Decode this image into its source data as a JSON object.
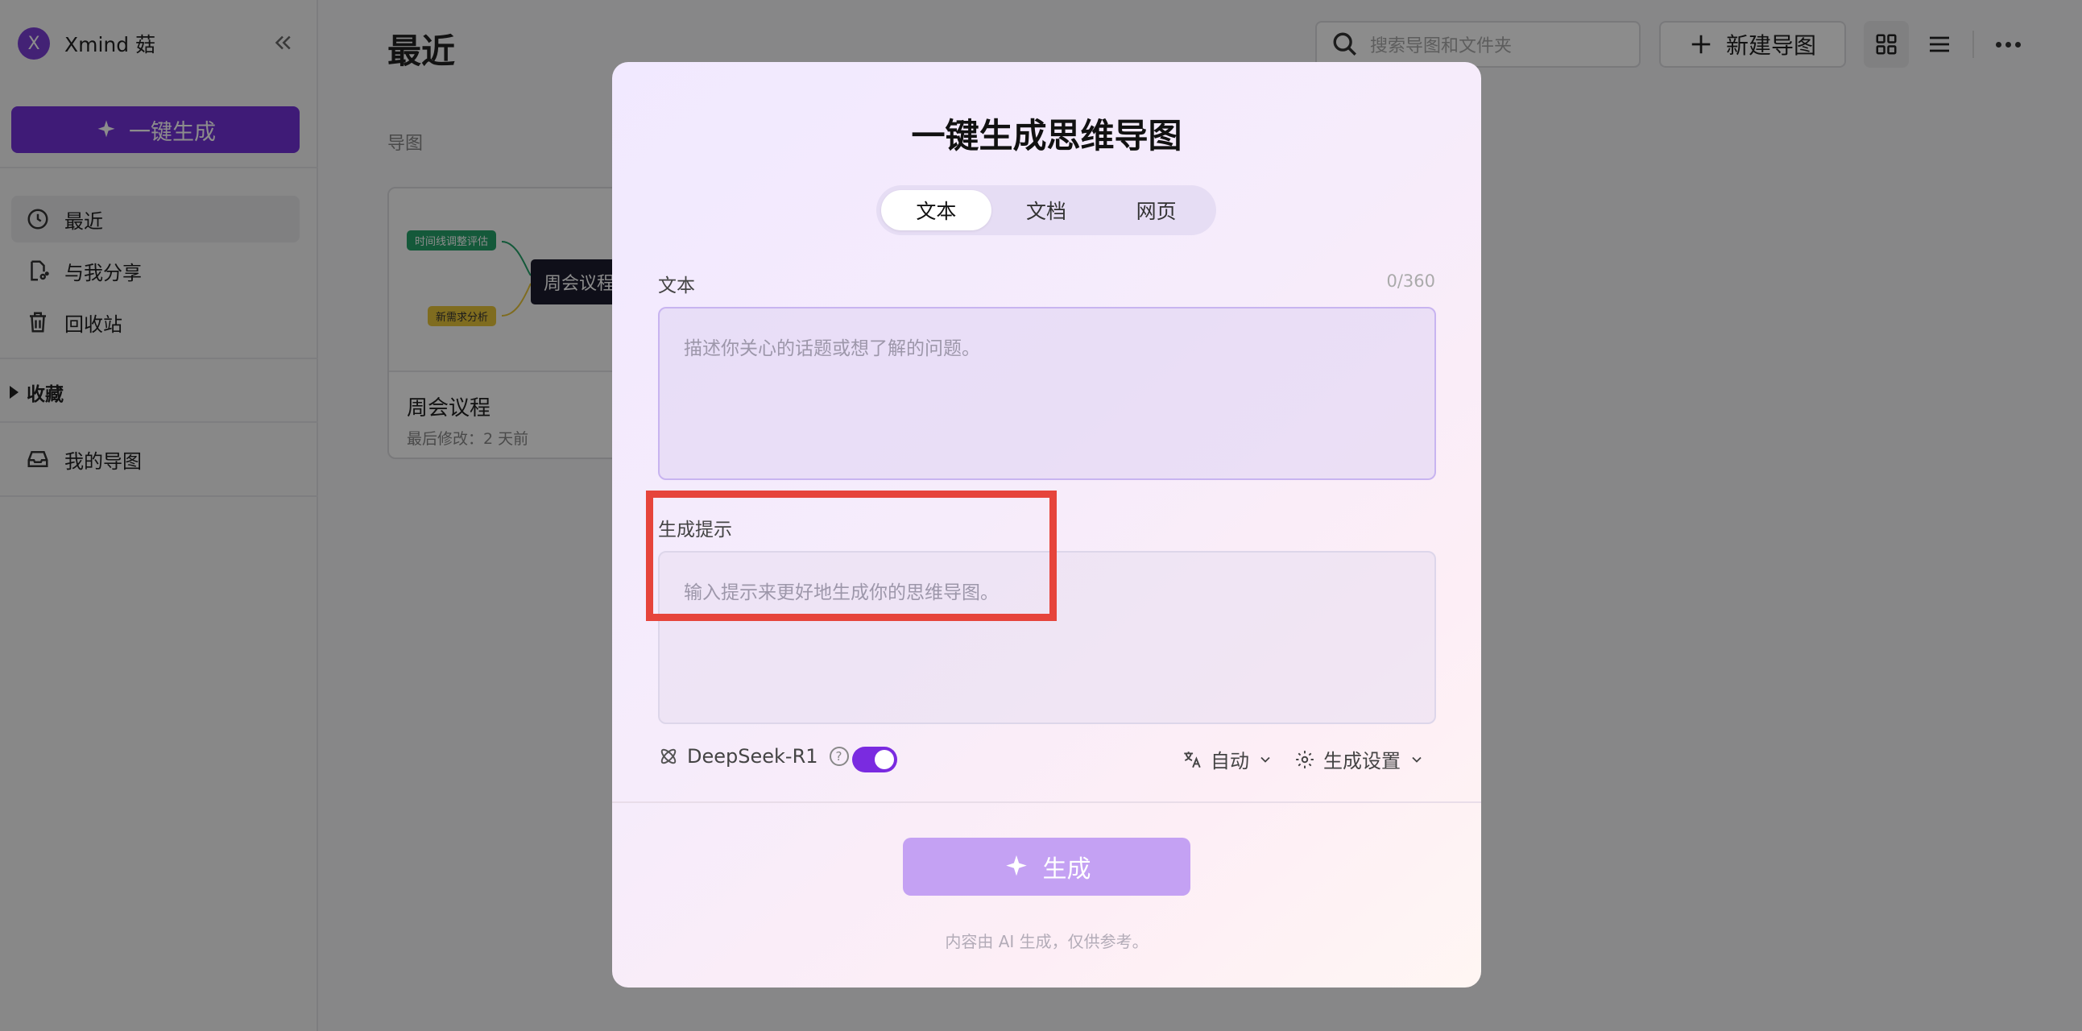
{
  "app": {
    "brand_initial": "X",
    "brand_name": "Xmind 菇",
    "one_click_label": "一键生成"
  },
  "sidebar": {
    "items": [
      {
        "label": "最近",
        "icon": "clock-icon",
        "active": true
      },
      {
        "label": "与我分享",
        "icon": "shared-doc-icon",
        "active": false
      },
      {
        "label": "回收站",
        "icon": "trash-icon",
        "active": false
      }
    ],
    "favorites_label": "收藏",
    "my_maps_label": "我的导图"
  },
  "main": {
    "title": "最近",
    "section_label": "导图",
    "search_placeholder": "搜索导图和文件夹",
    "new_map_label": "新建导图",
    "card": {
      "title": "周会议程",
      "subtitle": "最后修改：2 天前",
      "thumb_nodes": {
        "central": "周会议程",
        "green": "时间线调整评估",
        "yellow": "新需求分析"
      }
    }
  },
  "modal": {
    "title": "一键生成思维导图",
    "tabs": [
      {
        "label": "文本",
        "active": true
      },
      {
        "label": "文档",
        "active": false
      },
      {
        "label": "网页",
        "active": false
      }
    ],
    "text_label": "文本",
    "text_counter": "0/360",
    "text_placeholder": "描述你关心的话题或想了解的问题。",
    "hint_label": "生成提示",
    "hint_placeholder": "输入提示来更好地生成你的思维导图。",
    "model_name": "DeepSeek-R1",
    "model_toggle_on": true,
    "language_label": "自动",
    "settings_label": "生成设置",
    "submit_label": "生成",
    "disclaimer": "内容由 AI 生成，仅供参考。"
  },
  "colors": {
    "accent": "#7432d9",
    "toggle_on": "#7a2be0",
    "submit_disabled": "#c4a1f3",
    "highlight_box": "#e6443b"
  }
}
